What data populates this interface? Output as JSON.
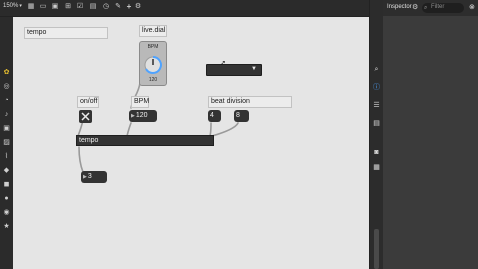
{
  "toolbar": {
    "zoom": "150%",
    "icons": [
      "grid-icon",
      "new-object-icon",
      "comment-icon",
      "message-icon",
      "inlet-icon",
      "present-icon",
      "clock-icon",
      "annotate-icon",
      "plus-icon",
      "debug-icon"
    ]
  },
  "patch": {
    "comments": {
      "tempo_label": "tempo",
      "live_dial": "live.dial",
      "onoff": "on/off",
      "bpm": "BPM",
      "beat_division": "beat division"
    },
    "dial": {
      "label": "BPM",
      "value": "120"
    },
    "number_boxes": {
      "bpm_value": "120",
      "div_a": "4",
      "div_b": "8",
      "output": "3"
    },
    "objects": {
      "tempo": "tempo"
    },
    "dropdown": {
      "value": ""
    }
  },
  "inspector": {
    "title": "Inspector",
    "filter_placeholder": "Filter"
  }
}
